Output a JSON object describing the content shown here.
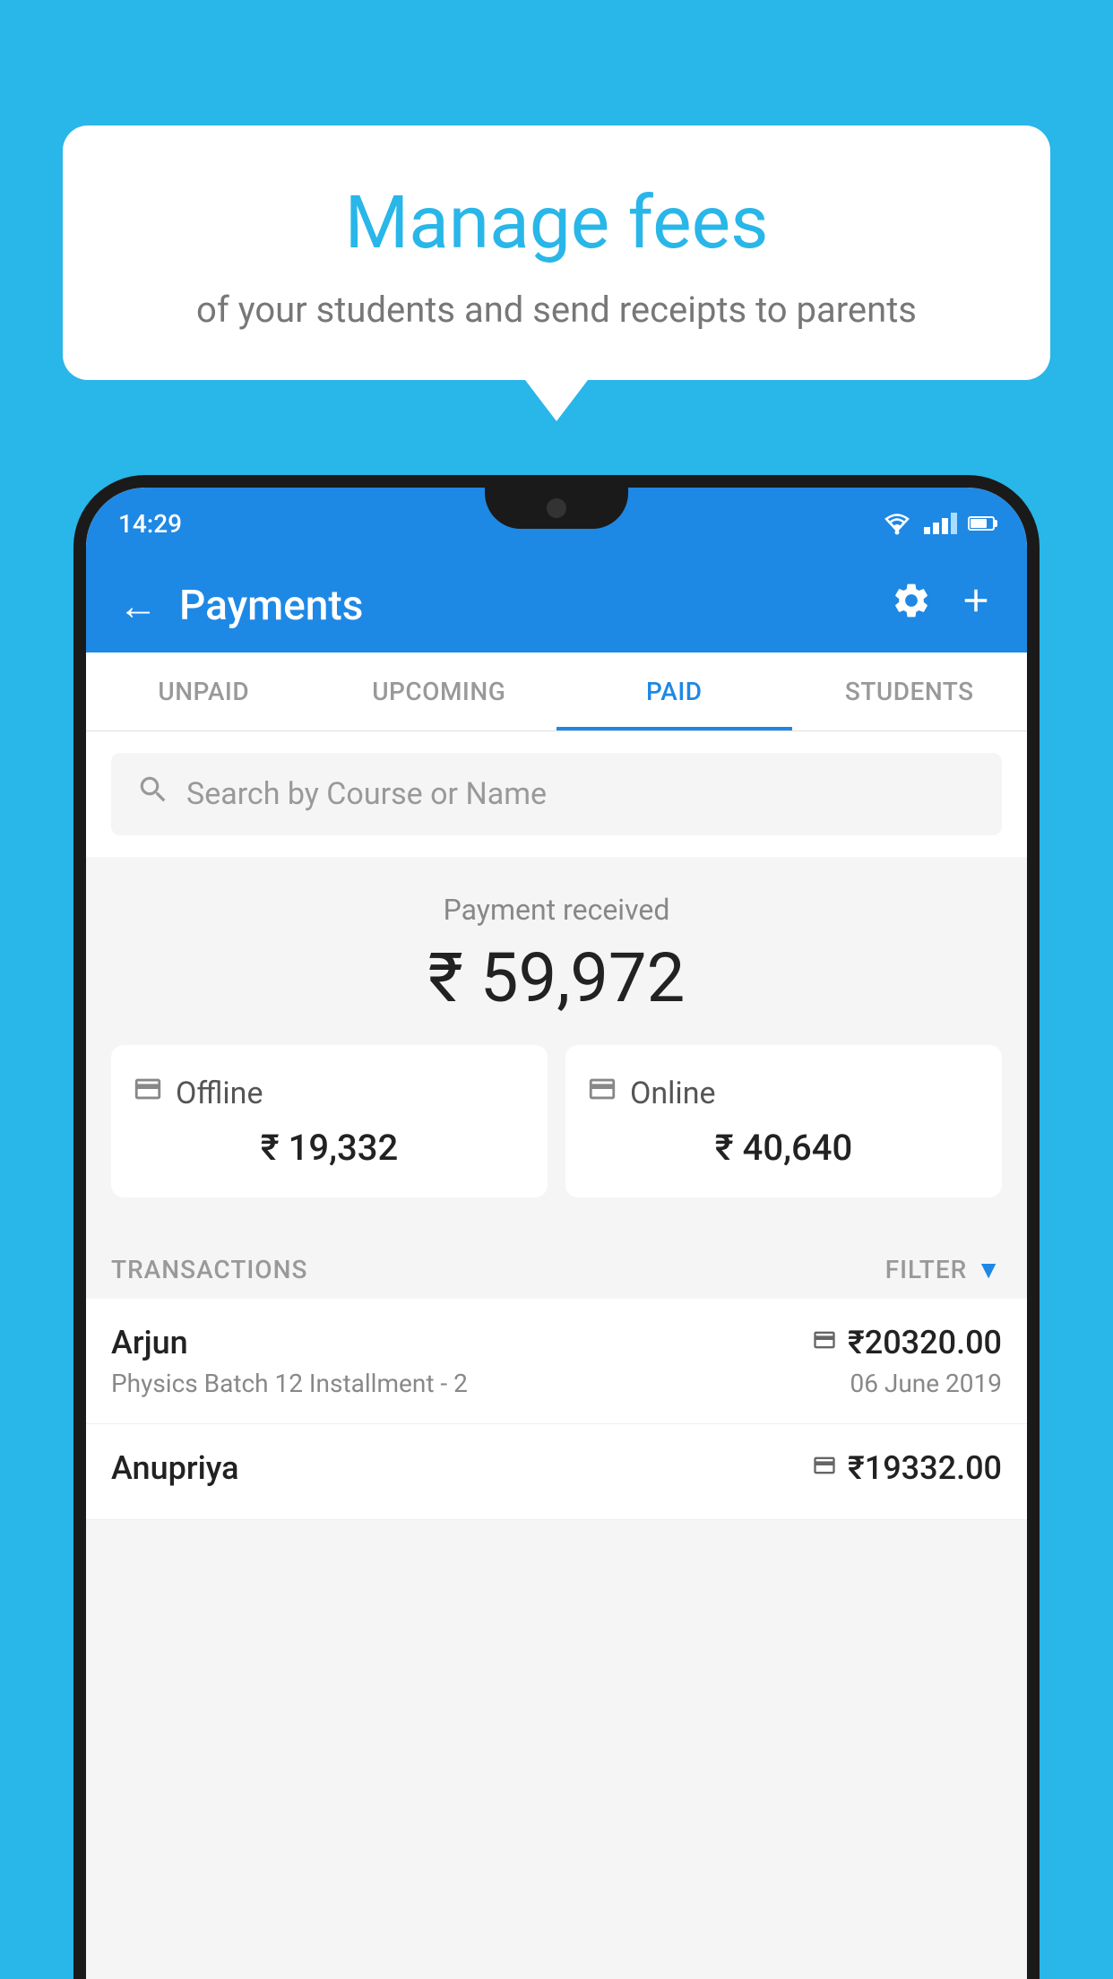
{
  "background_color": "#29b6e8",
  "bubble": {
    "title": "Manage fees",
    "subtitle": "of your students and send receipts to parents"
  },
  "status_bar": {
    "time": "14:29"
  },
  "header": {
    "title": "Payments",
    "back_label": "←"
  },
  "tabs": [
    {
      "id": "unpaid",
      "label": "UNPAID",
      "active": false
    },
    {
      "id": "upcoming",
      "label": "UPCOMING",
      "active": false
    },
    {
      "id": "paid",
      "label": "PAID",
      "active": true
    },
    {
      "id": "students",
      "label": "STUDENTS",
      "active": false
    }
  ],
  "search": {
    "placeholder": "Search by Course or Name"
  },
  "payment_summary": {
    "label": "Payment received",
    "amount": "₹ 59,972",
    "offline": {
      "label": "Offline",
      "amount": "₹ 19,332"
    },
    "online": {
      "label": "Online",
      "amount": "₹ 40,640"
    }
  },
  "transactions_header": {
    "label": "TRANSACTIONS",
    "filter_label": "FILTER"
  },
  "transactions": [
    {
      "name": "Arjun",
      "course": "Physics Batch 12 Installment - 2",
      "amount": "₹20320.00",
      "date": "06 June 2019",
      "payment_type": "card"
    },
    {
      "name": "Anupriya",
      "course": "",
      "amount": "₹19332.00",
      "date": "",
      "payment_type": "cash"
    }
  ]
}
